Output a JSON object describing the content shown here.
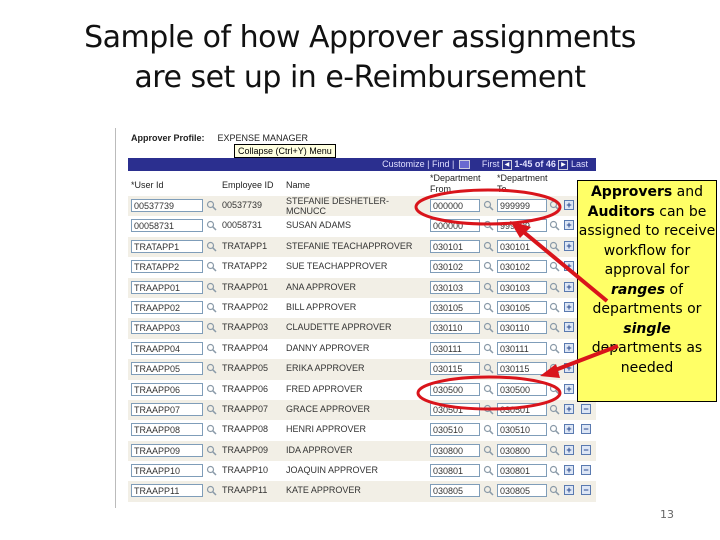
{
  "slide": {
    "title_line1": "Sample of how Approver assignments",
    "title_line2": "are set up in e-Reimbursement",
    "page_number": "13"
  },
  "screen": {
    "profile_label": "Approver Profile:",
    "profile_value": "EXPENSE MANAGER",
    "tooltip": "Collapse (Ctrl+Y) Menu",
    "nav": {
      "customize": "Customize",
      "find": "Find",
      "first": "First",
      "range": "1-45 of 46",
      "last": "Last"
    },
    "columns": {
      "user_id": "*User Id",
      "employee_id": "Employee ID",
      "name": "Name",
      "dept_from_1": "*Department",
      "dept_from_2": "From",
      "dept_to_1": "*Department",
      "dept_to_2": "To"
    },
    "rows": [
      {
        "user_id": "00537739",
        "employee_id": "00537739",
        "name": "STEFANIE DESHETLER-MCNUCC",
        "dept_from": "000000",
        "dept_to": "999999"
      },
      {
        "user_id": "00058731",
        "employee_id": "00058731",
        "name": "SUSAN ADAMS",
        "dept_from": "000000",
        "dept_to": "999999"
      },
      {
        "user_id": "TRATAPP1",
        "employee_id": "TRATAPP1",
        "name": "STEFANIE TEACHAPPROVER",
        "dept_from": "030101",
        "dept_to": "030101"
      },
      {
        "user_id": "TRATAPP2",
        "employee_id": "TRATAPP2",
        "name": "SUE TEACHAPPROVER",
        "dept_from": "030102",
        "dept_to": "030102"
      },
      {
        "user_id": "TRAAPP01",
        "employee_id": "TRAAPP01",
        "name": "ANA APPROVER",
        "dept_from": "030103",
        "dept_to": "030103"
      },
      {
        "user_id": "TRAAPP02",
        "employee_id": "TRAAPP02",
        "name": "BILL APPROVER",
        "dept_from": "030105",
        "dept_to": "030105"
      },
      {
        "user_id": "TRAAPP03",
        "employee_id": "TRAAPP03",
        "name": "CLAUDETTE APPROVER",
        "dept_from": "030110",
        "dept_to": "030110"
      },
      {
        "user_id": "TRAAPP04",
        "employee_id": "TRAAPP04",
        "name": "DANNY APPROVER",
        "dept_from": "030111",
        "dept_to": "030111"
      },
      {
        "user_id": "TRAAPP05",
        "employee_id": "TRAAPP05",
        "name": "ERIKA APPROVER",
        "dept_from": "030115",
        "dept_to": "030115"
      },
      {
        "user_id": "TRAAPP06",
        "employee_id": "TRAAPP06",
        "name": "FRED APPROVER",
        "dept_from": "030500",
        "dept_to": "030500"
      },
      {
        "user_id": "TRAAPP07",
        "employee_id": "TRAAPP07",
        "name": "GRACE APPROVER",
        "dept_from": "030501",
        "dept_to": "030501"
      },
      {
        "user_id": "TRAAPP08",
        "employee_id": "TRAAPP08",
        "name": "HENRI APPROVER",
        "dept_from": "030510",
        "dept_to": "030510"
      },
      {
        "user_id": "TRAAPP09",
        "employee_id": "TRAAPP09",
        "name": "IDA APPROVER",
        "dept_from": "030800",
        "dept_to": "030800"
      },
      {
        "user_id": "TRAAPP10",
        "employee_id": "TRAAPP10",
        "name": "JOAQUIN APPROVER",
        "dept_from": "030801",
        "dept_to": "030801"
      },
      {
        "user_id": "TRAAPP11",
        "employee_id": "TRAAPP11",
        "name": "KATE APPROVER",
        "dept_from": "030805",
        "dept_to": "030805"
      }
    ],
    "add_row_symbol": "+",
    "delete_row_symbol": "−"
  },
  "callout": {
    "p1_bold": "Approvers",
    "p1_rest": " and",
    "p2_bold": "Auditors",
    "p2_rest": " can be assigned to receive workflow for approval for",
    "p3_em": "ranges",
    "p3_rest": " of departments or",
    "p4_em": "single",
    "p4_rest": " departments as needed"
  },
  "colors": {
    "nav_bar": "#2b2f8f",
    "callout_bg": "#ffff66",
    "highlight": "#d9141b"
  }
}
